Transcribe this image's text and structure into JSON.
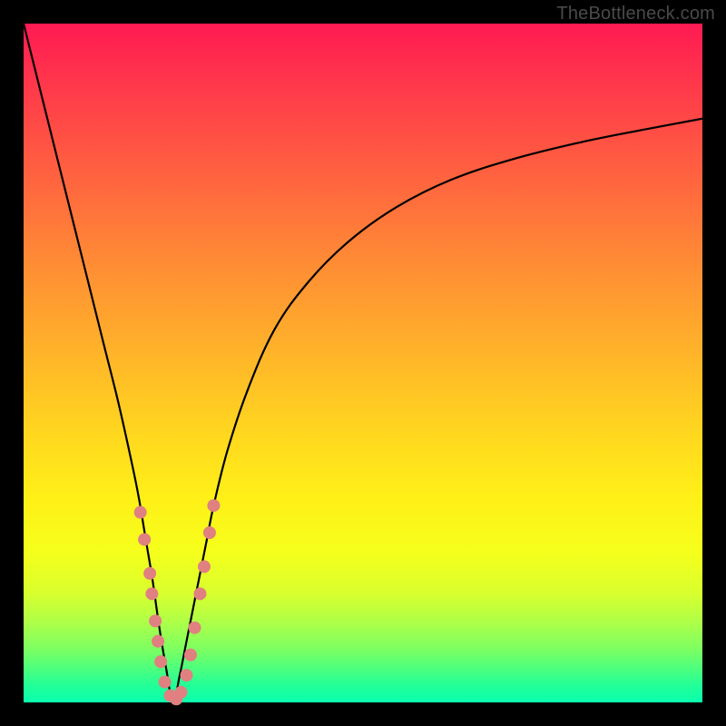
{
  "watermark": "TheBottleneck.com",
  "chart_data": {
    "type": "line",
    "title": "",
    "xlabel": "",
    "ylabel": "",
    "xlim": [
      0,
      100
    ],
    "ylim": [
      0,
      100
    ],
    "x_min_at": 22,
    "series": [
      {
        "name": "bottleneck-curve",
        "x": [
          0,
          2,
          4,
          6,
          8,
          10,
          12,
          14,
          16,
          17,
          18,
          19,
          20,
          21,
          22,
          23,
          24,
          25,
          26,
          27,
          28,
          30,
          33,
          37,
          42,
          48,
          55,
          63,
          72,
          82,
          92,
          100
        ],
        "y": [
          100,
          92,
          84,
          76,
          68,
          60,
          52,
          44,
          35,
          30,
          24,
          18,
          11,
          5,
          0,
          4,
          9,
          14,
          19,
          24,
          29,
          37,
          46,
          55,
          62,
          68,
          73,
          77,
          80,
          82.5,
          84.5,
          86
        ]
      }
    ],
    "markers": {
      "name": "highlight-dots",
      "color": "#e08080",
      "points": [
        {
          "x": 17.2,
          "y": 28
        },
        {
          "x": 17.8,
          "y": 24
        },
        {
          "x": 18.6,
          "y": 19
        },
        {
          "x": 18.9,
          "y": 16
        },
        {
          "x": 19.4,
          "y": 12
        },
        {
          "x": 19.8,
          "y": 9
        },
        {
          "x": 20.2,
          "y": 6
        },
        {
          "x": 20.8,
          "y": 3
        },
        {
          "x": 21.6,
          "y": 1
        },
        {
          "x": 22.5,
          "y": 0.5
        },
        {
          "x": 23.2,
          "y": 1.5
        },
        {
          "x": 24.0,
          "y": 4
        },
        {
          "x": 24.6,
          "y": 7
        },
        {
          "x": 25.2,
          "y": 11
        },
        {
          "x": 26.0,
          "y": 16
        },
        {
          "x": 26.6,
          "y": 20
        },
        {
          "x": 27.4,
          "y": 25
        },
        {
          "x": 28.0,
          "y": 29
        }
      ]
    }
  }
}
